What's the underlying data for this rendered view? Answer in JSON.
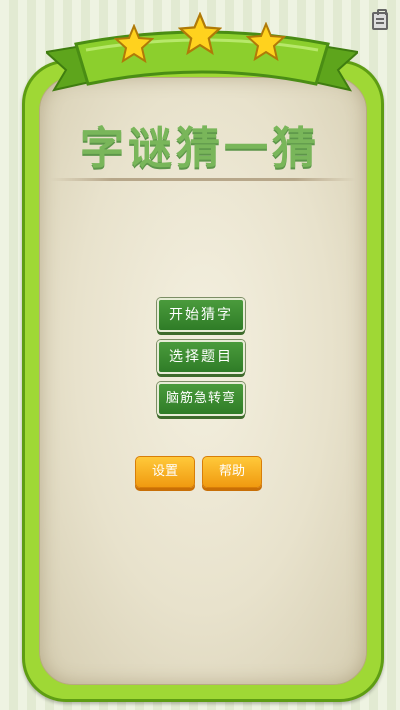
{
  "title": "字谜猜一猜",
  "menu": {
    "start_label": "开始猜字",
    "select_label": "选择题目",
    "riddle_label": "脑筋急转弯"
  },
  "footer": {
    "settings_label": "设置",
    "help_label": "帮助"
  },
  "rating": {
    "stars": 3,
    "max": 3
  },
  "colors": {
    "board": "#9fd835",
    "button_green": "#3a8b30",
    "button_orange": "#f7b324",
    "title": "#79b65a"
  },
  "icons": [
    "clipboard-icon",
    "star-icon"
  ]
}
